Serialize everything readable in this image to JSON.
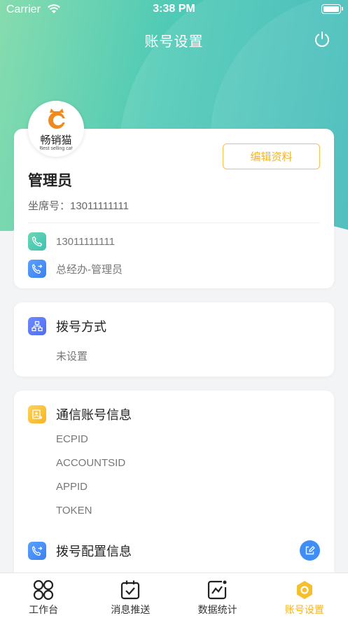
{
  "status_bar": {
    "carrier": "Carrier",
    "time": "3:38 PM"
  },
  "nav": {
    "title": "账号设置"
  },
  "logo": {
    "cn": "畅销猫",
    "en": "Best selling cat"
  },
  "profile": {
    "edit_label": "编辑资料",
    "name": "管理员",
    "seat": "坐席号：13011111111",
    "phone": "13011111111",
    "dept": "总经办-管理员"
  },
  "dial": {
    "title": "拨号方式",
    "value": "未设置"
  },
  "comm": {
    "title": "通信账号信息",
    "fields": [
      "ECPID",
      "ACCOUNTSID",
      "APPID",
      "TOKEN"
    ],
    "dial_config_title": "拨号配置信息"
  },
  "tabbar": {
    "items": [
      {
        "label": "工作台",
        "icon": "grid-icon"
      },
      {
        "label": "消息推送",
        "icon": "checkbox-icon"
      },
      {
        "label": "数据统计",
        "icon": "chart-icon"
      },
      {
        "label": "账号设置",
        "icon": "hexagon-icon"
      }
    ],
    "active_index": 3
  },
  "colors": {
    "accent": "#f0b529",
    "header_start": "#86dcae",
    "header_end": "#2fb3b4",
    "fab": "#3f8ef5"
  }
}
